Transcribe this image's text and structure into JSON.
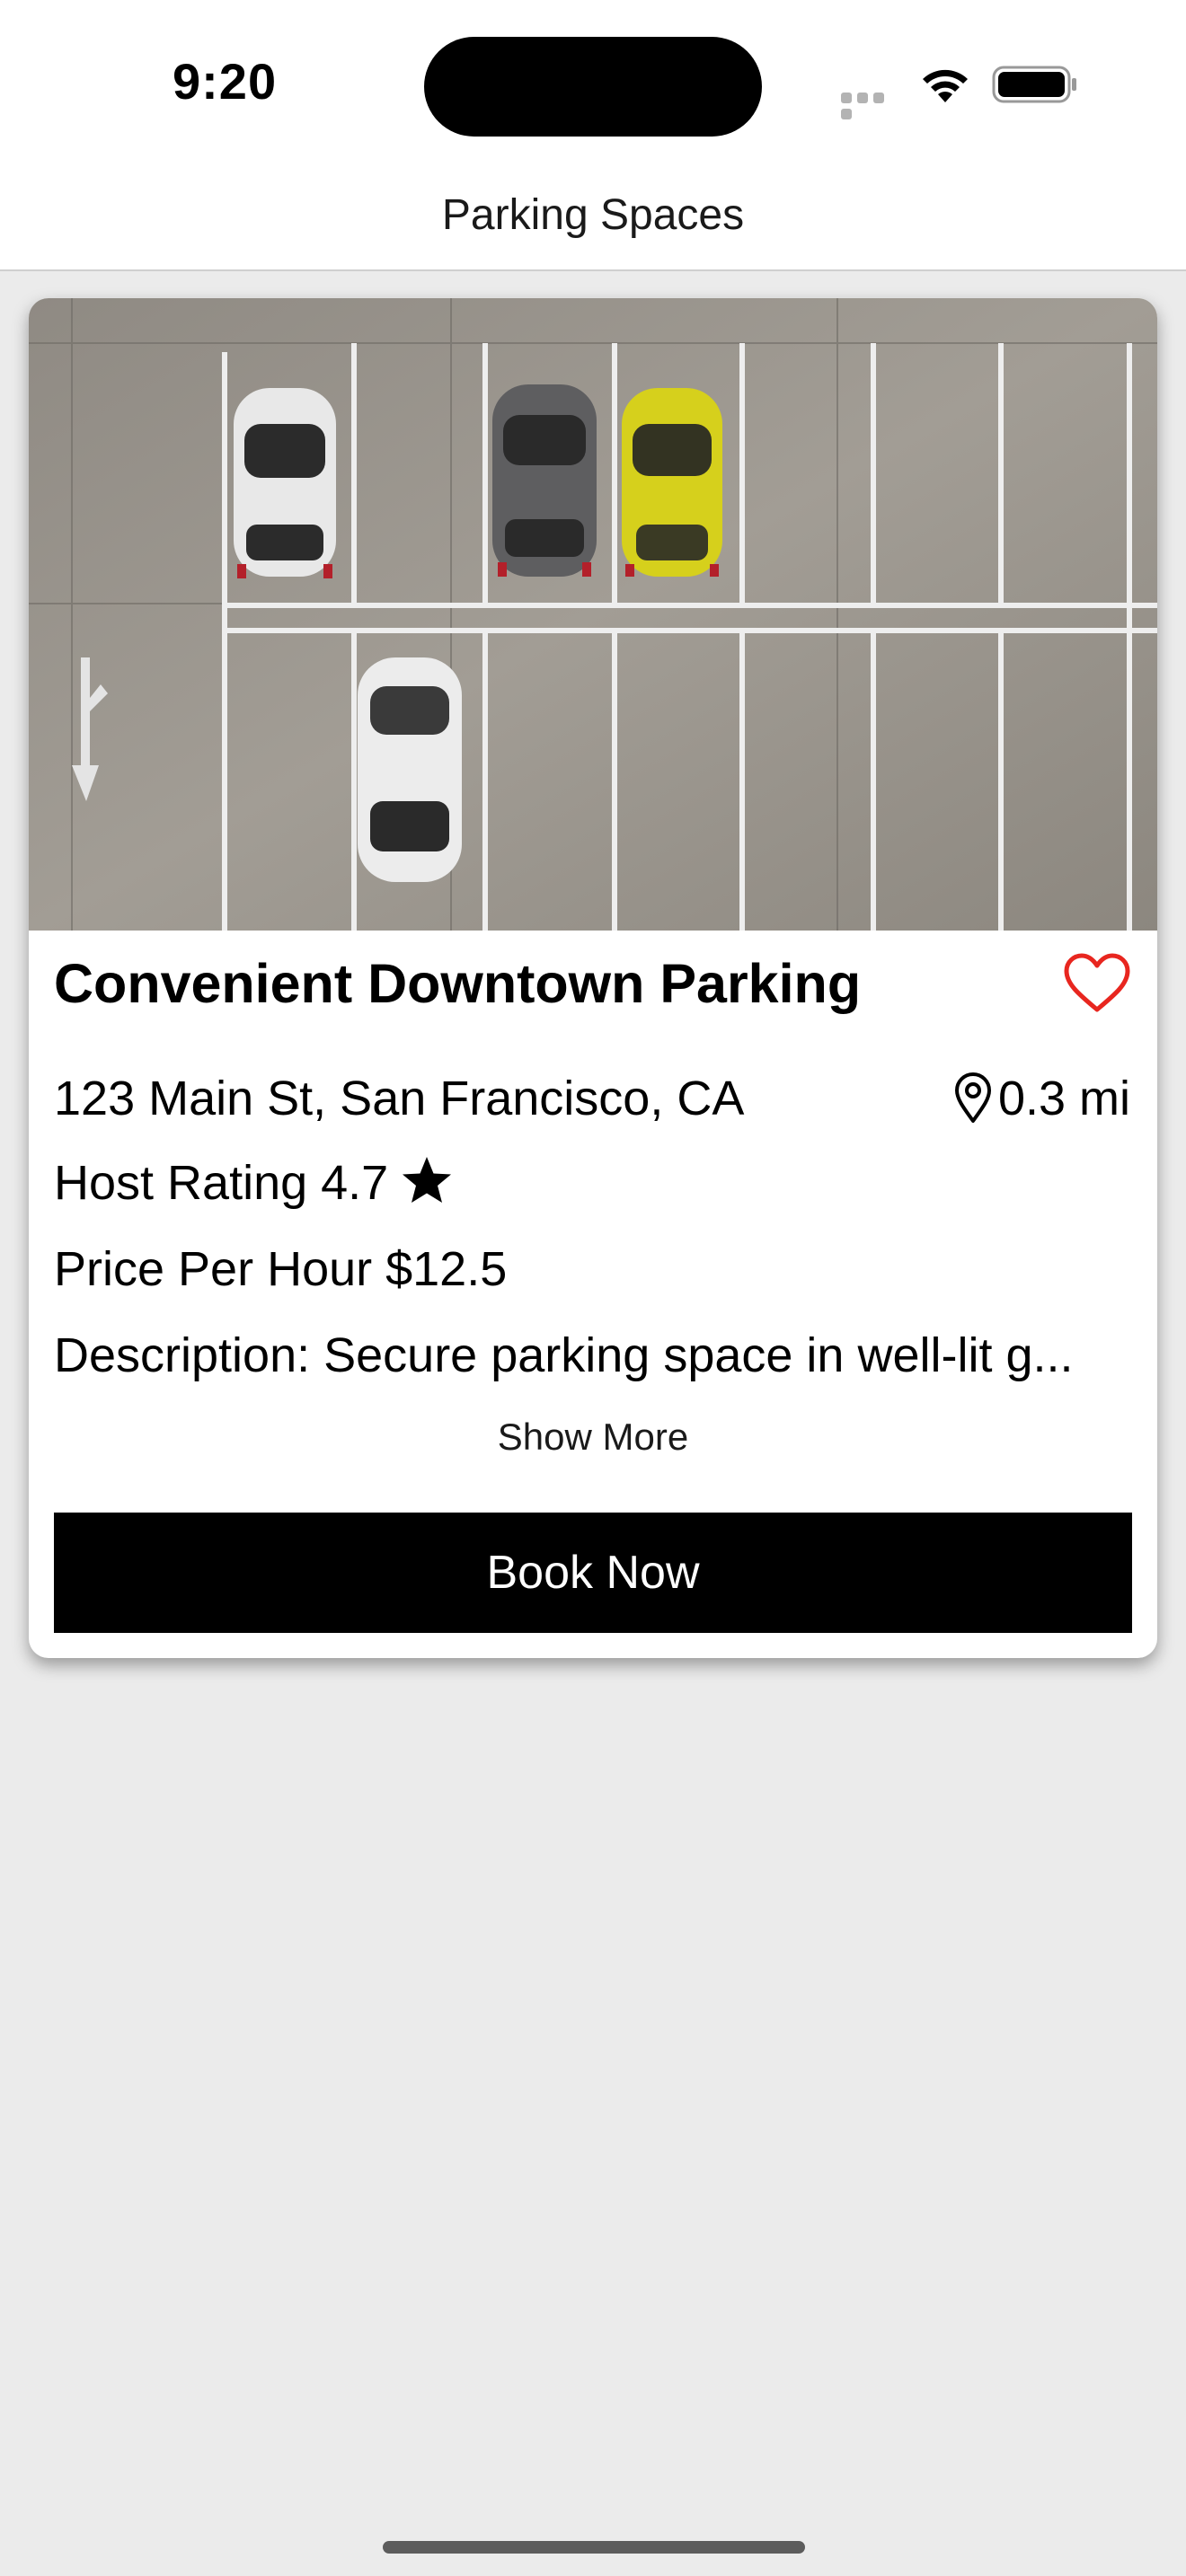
{
  "status_bar": {
    "time": "9:20"
  },
  "nav": {
    "title": "Parking Spaces"
  },
  "listing": {
    "image_icon": "parking-lot-photo",
    "title": "Convenient Downtown Parking",
    "favorite_icon": "heart-icon",
    "address": "123 Main St, San Francisco, CA",
    "distance": "0.3 mi",
    "rating_text": "Host Rating 4.7",
    "price_text": "Price Per Hour $12.5",
    "description": "Description: Secure parking space in well-lit g...",
    "show_more_label": "Show More",
    "book_label": "Book Now"
  },
  "colors": {
    "accent_heart": "#e8261f",
    "button_bg": "#000000",
    "page_bg": "#ebebeb"
  }
}
